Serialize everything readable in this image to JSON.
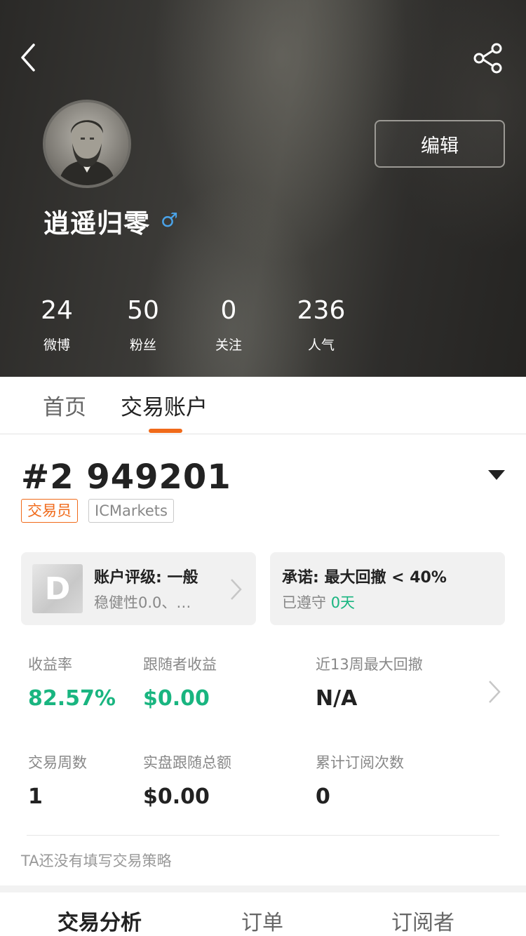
{
  "header": {
    "username": "逍遥归零",
    "gender_symbol": "♂",
    "edit_label": "编辑",
    "stats": [
      {
        "value": "24",
        "label": "微博"
      },
      {
        "value": "50",
        "label": "粉丝"
      },
      {
        "value": "0",
        "label": "关注"
      },
      {
        "value": "236",
        "label": "人气"
      }
    ]
  },
  "tabs": [
    {
      "label": "首页",
      "active": false
    },
    {
      "label": "交易账户",
      "active": true
    }
  ],
  "account": {
    "number": "#2 949201",
    "tags": [
      "交易员",
      "ICMarkets"
    ],
    "rating": {
      "grade": "D",
      "title": "账户评级: 一般",
      "subtitle": "稳健性0.0、…"
    },
    "promise": {
      "title": "承诺: 最大回撤 < 40%",
      "kept_prefix": "已遵守",
      "kept_value": "0天"
    }
  },
  "metrics": [
    {
      "label": "收益率",
      "value": "82.57%",
      "highlight": true
    },
    {
      "label": "跟随者收益",
      "value": "$0.00",
      "highlight": true
    },
    {
      "label": "近13周最大回撤",
      "value": "N/A",
      "highlight": false
    },
    {
      "label": "交易周数",
      "value": "1",
      "highlight": false
    },
    {
      "label": "实盘跟随总额",
      "value": "$0.00",
      "highlight": false
    },
    {
      "label": "累计订阅次数",
      "value": "0",
      "highlight": false
    }
  ],
  "strategy_text": "TA还没有填写交易策略",
  "bottom_tabs": [
    {
      "label": "交易分析",
      "active": true
    },
    {
      "label": "订单",
      "active": false
    },
    {
      "label": "订阅者",
      "active": false
    }
  ],
  "colors": {
    "accent": "#f06a1a",
    "positive": "#19b580",
    "gender": "#4aa3e8"
  }
}
